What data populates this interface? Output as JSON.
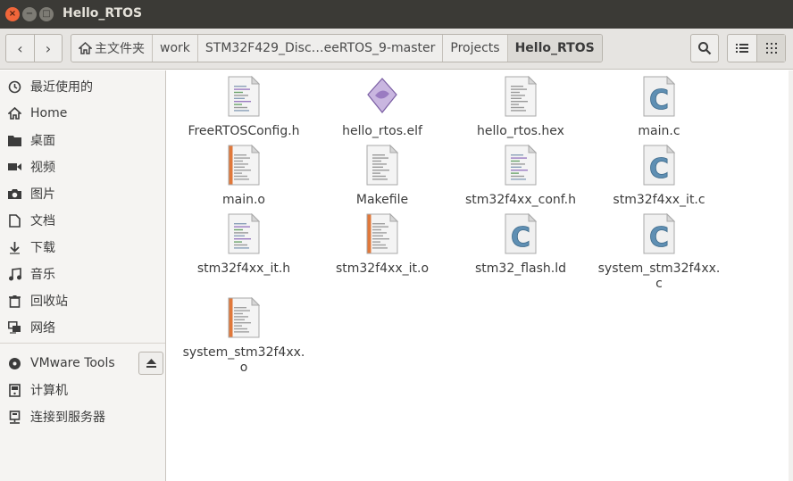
{
  "window": {
    "title": "Hello_RTOS",
    "close_glyph": "×",
    "min_glyph": "−",
    "max_glyph": "□"
  },
  "nav": {
    "back_glyph": "‹",
    "forward_glyph": "›"
  },
  "breadcrumbs": [
    {
      "label": "主文件夹",
      "icon": "home-icon"
    },
    {
      "label": "work"
    },
    {
      "label": "STM32F429_Disc…eeRTOS_9-master"
    },
    {
      "label": "Projects"
    },
    {
      "label": "Hello_RTOS",
      "active": true
    }
  ],
  "toolbar": {
    "search_icon": "search-icon",
    "list_view_icon": "list-view-icon",
    "grid_view_icon": "grid-view-icon"
  },
  "sidebar": {
    "places": [
      {
        "label": "最近使用的",
        "icon": "clock-icon"
      },
      {
        "label": "Home",
        "icon": "home-icon"
      },
      {
        "label": "桌面",
        "icon": "folder-icon"
      },
      {
        "label": "视频",
        "icon": "video-icon"
      },
      {
        "label": "图片",
        "icon": "camera-icon"
      },
      {
        "label": "文档",
        "icon": "document-icon"
      },
      {
        "label": "下载",
        "icon": "download-icon"
      },
      {
        "label": "音乐",
        "icon": "music-icon"
      },
      {
        "label": "回收站",
        "icon": "trash-icon"
      },
      {
        "label": "网络",
        "icon": "network-icon"
      }
    ],
    "devices": [
      {
        "label": "VMware Tools",
        "icon": "disc-icon",
        "eject": true
      },
      {
        "label": "计算机",
        "icon": "computer-icon"
      },
      {
        "label": "连接到服务器",
        "icon": "server-icon"
      }
    ]
  },
  "files": [
    {
      "name": "FreeRTOSConfig.h",
      "type": "header"
    },
    {
      "name": "hello_rtos.elf",
      "type": "elf"
    },
    {
      "name": "hello_rtos.hex",
      "type": "text"
    },
    {
      "name": "main.c",
      "type": "c"
    },
    {
      "name": "main.o",
      "type": "object"
    },
    {
      "name": "Makefile",
      "type": "text"
    },
    {
      "name": "stm32f4xx_conf.h",
      "type": "header"
    },
    {
      "name": "stm32f4xx_it.c",
      "type": "c"
    },
    {
      "name": "stm32f4xx_it.h",
      "type": "header"
    },
    {
      "name": "stm32f4xx_it.o",
      "type": "object"
    },
    {
      "name": "stm32_flash.ld",
      "type": "c"
    },
    {
      "name": "system_stm32f4xx.\nc",
      "type": "c"
    },
    {
      "name": "system_stm32f4xx.\no",
      "type": "object"
    }
  ],
  "colors": {
    "titlebar": "#3b3a36",
    "close": "#f0663a",
    "c_icon": "#5f8fb3",
    "object_stripe": "#e0783a",
    "elf_icon": "#9a7bc1"
  }
}
